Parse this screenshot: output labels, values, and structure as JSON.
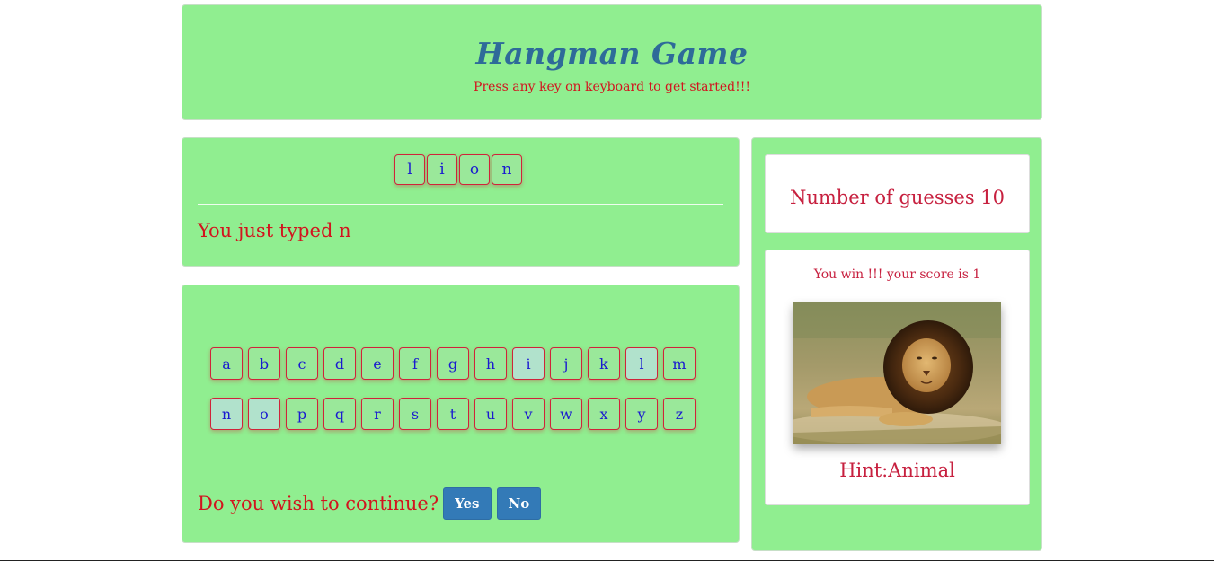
{
  "header": {
    "title": "Hangman Game",
    "subtitle": "Press any key on keyboard to get started!!!"
  },
  "word": {
    "letters": [
      "l",
      "i",
      "o",
      "n"
    ],
    "last_typed": "You just typed n"
  },
  "keyboard": {
    "row1": [
      "a",
      "b",
      "c",
      "d",
      "e",
      "f",
      "g",
      "h",
      "i",
      "j",
      "k",
      "l",
      "m"
    ],
    "row2": [
      "n",
      "o",
      "p",
      "q",
      "r",
      "s",
      "t",
      "u",
      "v",
      "w",
      "x",
      "y",
      "z"
    ],
    "used_letters": [
      "i",
      "l",
      "n",
      "o"
    ]
  },
  "continue": {
    "prompt": "Do you wish to continue?",
    "yes_label": "Yes",
    "no_label": "No"
  },
  "side": {
    "guesses_text": "Number of guesses 10",
    "result_text": "You win !!! your score is 1",
    "hint_text": "Hint:Animal"
  },
  "colors": {
    "panel_green": "#90ee90",
    "accent_red": "#d2141e",
    "letter_blue": "#1a1ad0",
    "button_blue": "#337ab7",
    "title_blue": "#2e6b99"
  }
}
